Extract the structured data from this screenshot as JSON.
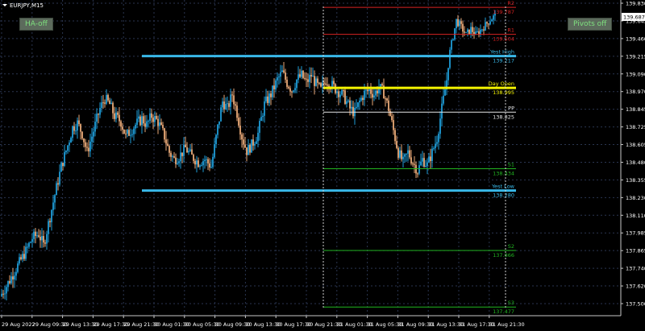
{
  "symbol_title": "EURJPY,M15",
  "buttons": {
    "ha": "HA-off",
    "pivots": "Pivots off"
  },
  "colors": {
    "background": "#000000",
    "grid": "#2a3550",
    "axis": "#c8c8c8",
    "bull": "#1e9bd6",
    "bear": "#e8a877",
    "red": "#d62222",
    "yellow": "#f4f400",
    "white": "#e6e6e6",
    "green": "#21b521",
    "blue_level": "#39b8e8"
  },
  "chart_data": {
    "type": "candlestick",
    "ylim": [
      137.477,
      139.83
    ],
    "y_ticks": [
      "139.830",
      "139.645",
      "139.460",
      "139.215",
      "139.090",
      "138.970",
      "138.845",
      "138.725",
      "138.605",
      "138.480",
      "138.355",
      "138.230",
      "138.110",
      "137.985",
      "137.865",
      "137.740",
      "137.620",
      "137.500"
    ],
    "current_price": "139.687",
    "x_ticks": [
      "29 Aug 2022",
      "29 Aug 09:30",
      "29 Aug 13:30",
      "29 Aug 17:30",
      "29 Aug 21:30",
      "30 Aug 01:30",
      "30 Aug 05:30",
      "30 Aug 09:30",
      "30 Aug 13:30",
      "30 Aug 17:30",
      "30 Aug 21:30",
      "31 Aug 01:30",
      "31 Aug 05:30",
      "31 Aug 09:30",
      "31 Aug 13:30",
      "31 Aug 17:30",
      "31 Aug 21:30"
    ],
    "levels": [
      {
        "label": "R2",
        "value": "139.787",
        "color_key": "red",
        "price": 139.787
      },
      {
        "label": "R1",
        "value": "139.504",
        "color_key": "red",
        "price": 139.504
      },
      {
        "label": "Yest High",
        "value": "139.217",
        "color_key": "blue_level",
        "price": 139.217
      },
      {
        "label": "Day Open",
        "value": "138.995",
        "color_key": "yellow",
        "price": 138.995
      },
      {
        "label": "PP",
        "value": "138.825",
        "color_key": "white",
        "price": 138.825
      },
      {
        "label": "S1",
        "value": "138.434",
        "color_key": "green",
        "price": 138.434
      },
      {
        "label": "Yest Low",
        "value": "138.280",
        "color_key": "blue_level",
        "price": 138.28
      },
      {
        "label": "S2",
        "value": "137.866",
        "color_key": "green",
        "price": 137.866
      },
      {
        "label": "S3",
        "value": "137.477",
        "color_key": "green",
        "price": 137.477
      }
    ],
    "price_path": [
      [
        0,
        137.55
      ],
      [
        8,
        137.62
      ],
      [
        16,
        137.7
      ],
      [
        24,
        137.78
      ],
      [
        32,
        137.86
      ],
      [
        40,
        137.95
      ],
      [
        48,
        137.98
      ],
      [
        54,
        137.9
      ],
      [
        60,
        138.05
      ],
      [
        68,
        138.25
      ],
      [
        76,
        138.45
      ],
      [
        84,
        138.6
      ],
      [
        90,
        138.72
      ],
      [
        96,
        138.75
      ],
      [
        102,
        138.68
      ],
      [
        108,
        138.55
      ],
      [
        116,
        138.7
      ],
      [
        124,
        138.85
      ],
      [
        130,
        138.92
      ],
      [
        136,
        138.88
      ],
      [
        142,
        138.8
      ],
      [
        150,
        138.76
      ],
      [
        156,
        138.66
      ],
      [
        162,
        138.7
      ],
      [
        168,
        138.74
      ],
      [
        176,
        138.78
      ],
      [
        182,
        138.74
      ],
      [
        188,
        138.8
      ],
      [
        196,
        138.76
      ],
      [
        204,
        138.66
      ],
      [
        210,
        138.55
      ],
      [
        216,
        138.5
      ],
      [
        222,
        138.52
      ],
      [
        230,
        138.58
      ],
      [
        238,
        138.52
      ],
      [
        246,
        138.48
      ],
      [
        254,
        138.5
      ],
      [
        262,
        138.45
      ],
      [
        270,
        138.72
      ],
      [
        276,
        138.9
      ],
      [
        282,
        138.85
      ],
      [
        288,
        138.95
      ],
      [
        294,
        138.82
      ],
      [
        300,
        138.66
      ],
      [
        306,
        138.56
      ],
      [
        312,
        138.6
      ],
      [
        320,
        138.68
      ],
      [
        328,
        138.88
      ],
      [
        336,
        138.95
      ],
      [
        344,
        139.05
      ],
      [
        350,
        139.1
      ],
      [
        356,
        139.03
      ],
      [
        362,
        138.98
      ],
      [
        368,
        139.05
      ],
      [
        374,
        139.08
      ],
      [
        380,
        139.03
      ],
      [
        386,
        139.08
      ],
      [
        392,
        139.02
      ],
      [
        398,
        138.98
      ],
      [
        404,
        139.05
      ],
      [
        410,
        139.02
      ],
      [
        418,
        138.98
      ],
      [
        426,
        138.94
      ],
      [
        434,
        138.85
      ],
      [
        440,
        138.82
      ],
      [
        446,
        138.9
      ],
      [
        452,
        138.96
      ],
      [
        458,
        138.98
      ],
      [
        464,
        138.95
      ],
      [
        470,
        139.0
      ],
      [
        476,
        138.96
      ],
      [
        482,
        138.85
      ],
      [
        488,
        138.7
      ],
      [
        494,
        138.55
      ],
      [
        500,
        138.48
      ],
      [
        506,
        138.55
      ],
      [
        512,
        138.48
      ],
      [
        518,
        138.42
      ],
      [
        524,
        138.5
      ],
      [
        530,
        138.46
      ],
      [
        536,
        138.55
      ],
      [
        542,
        138.65
      ],
      [
        548,
        138.85
      ],
      [
        554,
        139.05
      ],
      [
        560,
        139.4
      ],
      [
        566,
        139.65
      ],
      [
        572,
        139.58
      ],
      [
        578,
        139.5
      ],
      [
        584,
        139.56
      ],
      [
        590,
        139.5
      ],
      [
        596,
        139.55
      ],
      [
        602,
        139.6
      ],
      [
        608,
        139.66
      ],
      [
        614,
        139.7
      ]
    ]
  }
}
